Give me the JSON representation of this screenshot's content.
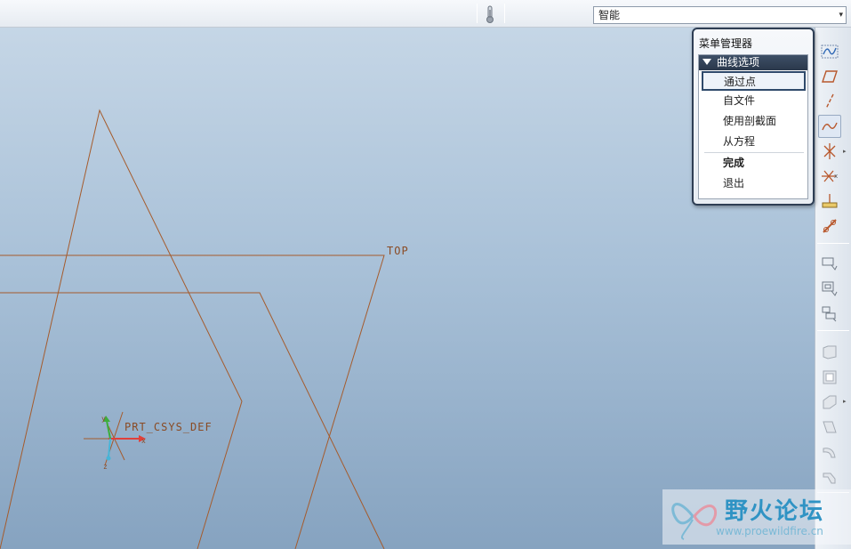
{
  "toolbar": {
    "filter_value": "智能",
    "filter_arrow": "▾"
  },
  "viewport": {
    "datum_plane_label": "TOP",
    "csys_label": "PRT_CSYS_DEF",
    "axis_x": "x",
    "axis_y": "y",
    "axis_z": "z",
    "line_color": "#a55b2c"
  },
  "menu_manager": {
    "title": "菜单管理器",
    "section": "曲线选项",
    "items": [
      "通过点",
      "自文件",
      "使用剖截面",
      "从方程"
    ],
    "selected_index": 0,
    "actions": [
      "完成",
      "退出"
    ]
  },
  "right_toolbar": {
    "icons": [
      "sketch-datum-curve-icon",
      "datum-plane-icon",
      "datum-axis-icon",
      "datum-curve-icon",
      "datum-point-icon",
      "point-offset-icon",
      "analysis-icon",
      "insert-feature-icon",
      "mirror-icon",
      "move-icon",
      "group-icon",
      "extrude-icon",
      "shell-icon",
      "rib-icon",
      "draft-icon",
      "round-icon",
      "chamfer-icon"
    ]
  },
  "watermark": {
    "site_name": "野火论坛",
    "url": "www.proewildfire.cn"
  }
}
